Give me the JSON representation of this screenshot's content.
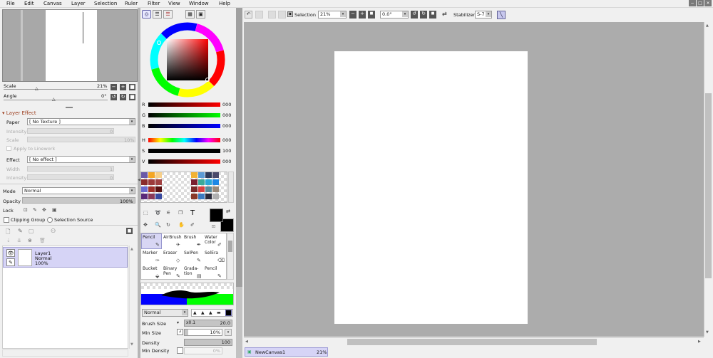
{
  "menu": [
    "File",
    "Edit",
    "Canvas",
    "Layer",
    "Selection",
    "Ruler",
    "Filter",
    "View",
    "Window",
    "Help"
  ],
  "window_buttons": [
    "−",
    "□",
    "✕"
  ],
  "nav": {
    "scale_label": "Scale",
    "scale_value": "21%",
    "angle_label": "Angle",
    "angle_value": "0°"
  },
  "layer_effect": {
    "header": "Layer Effect",
    "paper_label": "Paper",
    "paper_value": "[ No Texture ]",
    "intensity_label": "Intensity",
    "intensity_value": "0",
    "scale_label": "Scale",
    "scale_value": "10%",
    "apply_label": "Apply to Linework",
    "effect_label": "Effect",
    "effect_value": "[ No effect ]",
    "width_label": "Width",
    "width_value": "1",
    "intensity2_label": "Intensity",
    "intensity2_value": "0"
  },
  "layer_props": {
    "mode_label": "Mode",
    "mode_value": "Normal",
    "opacity_label": "Opacity",
    "opacity_value": "100%",
    "lock_label": "Lock",
    "clipping_label": "Clipping Group",
    "selsource_label": "Selection Source"
  },
  "layers": [
    {
      "name": "Layer1",
      "mode": "Normal",
      "opacity": "100%"
    }
  ],
  "color": {
    "r_label": "R",
    "r_value": "000",
    "g_label": "G",
    "g_value": "000",
    "b_label": "B",
    "b_value": "000",
    "h_label": "H",
    "h_value": "000",
    "s_label": "S",
    "s_value": "100",
    "v_label": "V",
    "v_value": "000",
    "primary": "#000000",
    "secondary": "#000000"
  },
  "tools": [
    {
      "label": "Pencil"
    },
    {
      "label": "AirBrush"
    },
    {
      "label": "Brush"
    },
    {
      "label": "Water\nColor"
    },
    {
      "label": "Marker"
    },
    {
      "label": "Eraser"
    },
    {
      "label": "SelPen"
    },
    {
      "label": "SelEra"
    },
    {
      "label": "Bucket"
    },
    {
      "label": "Binary\nPen"
    },
    {
      "label": "Grada-\ntion"
    },
    {
      "label": "Pencil"
    }
  ],
  "brush": {
    "mode_value": "Normal",
    "size_label": "Brush Size",
    "size_multiplier": "x0.1",
    "size_value": "20.0",
    "minsize_label": "Min Size",
    "minsize_value": "10%",
    "density_label": "Density",
    "density_value": "100",
    "mindensity_label": "Min Density",
    "mindensity_value": "0%"
  },
  "toolbar": {
    "selection_label": "Selection",
    "zoom_value": "21%",
    "angle_value": "0.0°",
    "stabilizer_label": "Stabilizer",
    "stabilizer_value": "S-7"
  },
  "canvas_tab": {
    "name": "NewCanvas1",
    "zoom": "21%"
  },
  "swatches": [
    "#6b5aa8",
    "#f5a623",
    "#f7d08a",
    "#f2b233",
    "#5b9bd5",
    "#2e3a59",
    "#4a4a6a",
    "#8a2b2b",
    "#9c3a3a",
    "#a04040",
    "#7a1f2f",
    "#3aaa9a",
    "#2aa8d8",
    "#1e88e5",
    "#6a6acf",
    "#a0302a",
    "#5a1010",
    "#7a2a2a",
    "#d84040",
    "#5a8a9a",
    "#9a8a7a",
    "#5a2a7a",
    "#8a3a5a",
    "#3a4aa0",
    "#8a3a2a",
    "#3a7ac0",
    "#2a2a3a",
    "#b0b0b0"
  ]
}
